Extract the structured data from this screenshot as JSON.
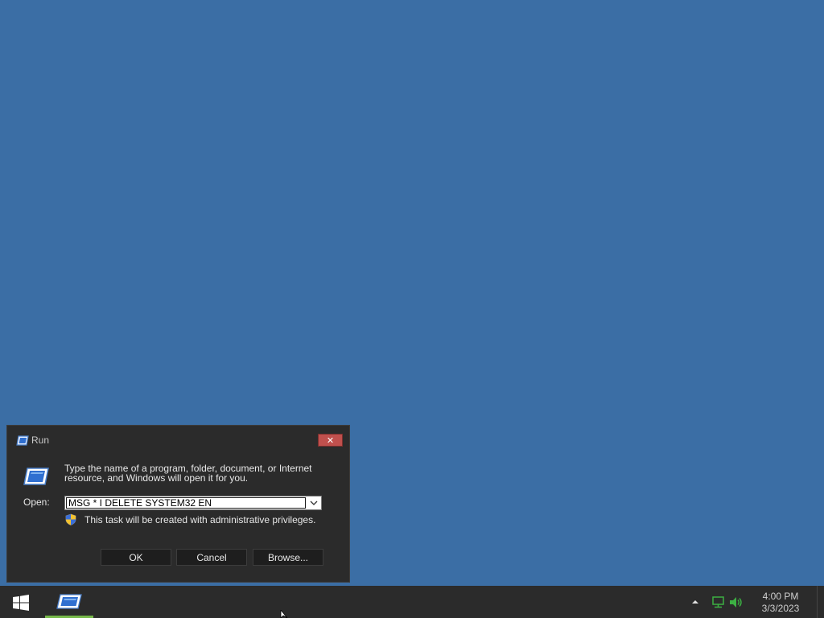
{
  "run_dialog": {
    "title": "Run",
    "description": "Type the name of a program, folder, document, or Internet resource, and Windows will open it for you.",
    "open_label": "Open:",
    "open_value": "MSG * I DELETE SYSTEM32 EN",
    "admin_note": "This task will be created with administrative privileges.",
    "buttons": {
      "ok": "OK",
      "cancel": "Cancel",
      "browse": "Browse..."
    },
    "close_glyph": "✕"
  },
  "taskbar": {
    "pinned": [
      {
        "icon": "run-app-icon",
        "active": true
      }
    ],
    "clock": {
      "time": "4:00 PM",
      "date": "3/3/2023"
    }
  },
  "colors": {
    "desktop": "#3b6ea5",
    "close_button": "#c0504d",
    "active_indicator": "#76b84a",
    "tray_icons": "#3cb043"
  }
}
